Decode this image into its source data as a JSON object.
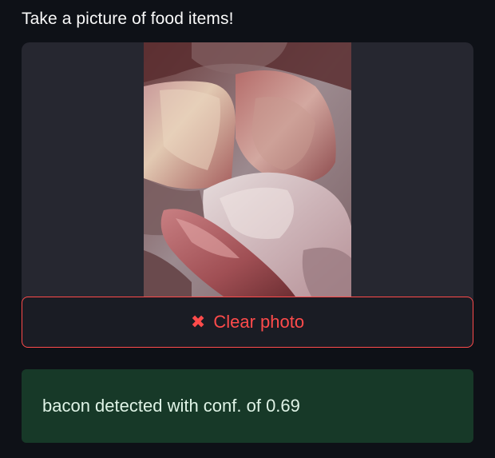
{
  "camera": {
    "prompt": "Take a picture of food items!",
    "photo_alt": "Photo of raw meat pieces",
    "clear_label": "Clear photo",
    "clear_icon": "close-x-icon"
  },
  "result": {
    "message": "bacon detected with conf. of 0.69"
  },
  "colors": {
    "background": "#0e1117",
    "panel": "#262730",
    "accent": "#ff4b4b",
    "success_bg": "#173928",
    "success_text": "#dff3e6"
  }
}
